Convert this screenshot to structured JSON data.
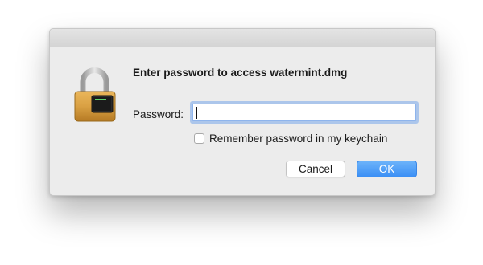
{
  "dialog": {
    "heading": "Enter password to access watermint.dmg",
    "password_label": "Password:",
    "password_value": "",
    "remember_label": "Remember password in my keychain",
    "remember_checked": false,
    "cancel_label": "Cancel",
    "ok_label": "OK",
    "icon": "lock-icon",
    "colors": {
      "lock_gold": "#d9a043",
      "shackle": "#c8c8c8",
      "ok_blue": "#3b8ff5",
      "focus_ring": "#8eb4ec"
    }
  }
}
